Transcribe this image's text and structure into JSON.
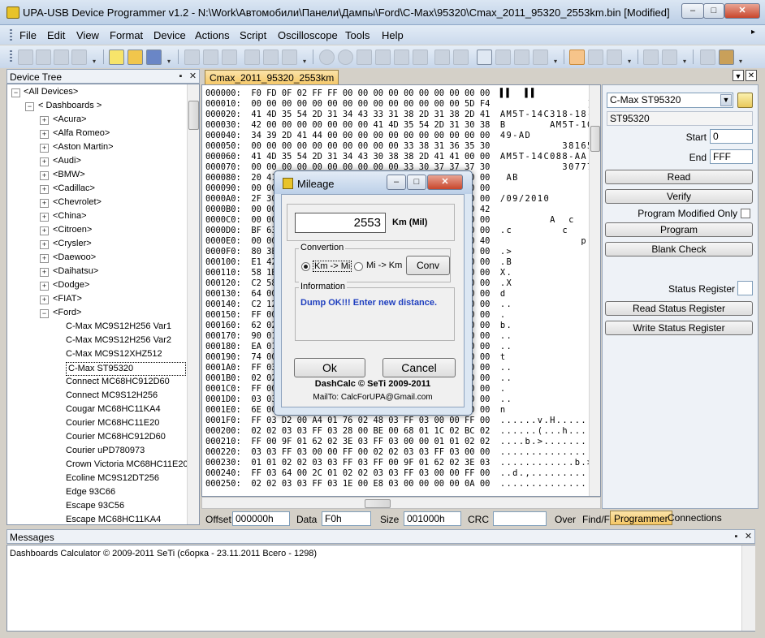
{
  "window": {
    "title": "UPA-USB Device Programmer v1.2 - N:\\Work\\Автомобили\\Панели\\Дампы\\Ford\\C-Max\\95320\\Cmax_2011_95320_2553km.bin [Modified]",
    "minimize": "–",
    "maximize": "□",
    "close": "✕"
  },
  "menu": [
    "File",
    "Edit",
    "View",
    "Format",
    "Device",
    "Actions",
    "Script",
    "Oscilloscope",
    "Tools",
    "Help"
  ],
  "device_tree": {
    "title": "Device Tree",
    "pin": "▪",
    "close": "✕",
    "root": "<All Devices>",
    "group": "< Dashboards >",
    "brands": [
      "<Acura>",
      "<Alfa Romeo>",
      "<Aston Martin>",
      "<Audi>",
      "<BMW>",
      "<Cadillac>",
      "<Chevrolet>",
      "<China>",
      "<Citroen>",
      "<Crysler>",
      "<Daewoo>",
      "<Daihatsu>",
      "<Dodge>",
      "<FIAT>"
    ],
    "open_brand": "<Ford>",
    "ford_items": [
      "C-Max MC9S12H256 Var1",
      "C-Max MC9S12H256 Var2",
      "C-Max MC9S12XHZ512",
      "C-Max ST95320",
      "Connect MC68HC912D60",
      "Connect MC9S12H256",
      "Cougar MC68HC11KA4",
      "Courier MC68HC11E20",
      "Courier MC68HC912D60",
      "Courier uPD780973",
      "Crown Victoria MC68HC11E20",
      "Ecoline MC9S12DT256",
      "Edge 93C66",
      "Escape 93C56",
      "Escape MC68HC11KA4"
    ],
    "selected_index": 3
  },
  "document_tab": "Cmax_2011_95320_2553km",
  "hex": {
    "rows": [
      {
        "addr": "000000:",
        "bytes": "F0 FD 0F 02 FF FF 00 00 00 00 00 00 00 00 00 00",
        "ascii": "▌▌  ▌▌          "
      },
      {
        "addr": "000010:",
        "bytes": "00 00 00 00 00 00 00 00 00 00 00 00 00 00 5D F4",
        "ascii": "              ]."
      },
      {
        "addr": "000020:",
        "bytes": "41 4D 35 54 2D 31 34 43 33 31 38 2D 31 38 2D 41",
        "ascii": "AM5T-14C318-18-A"
      },
      {
        "addr": "000030:",
        "bytes": "42 00 00 00 00 00 00 00 41 4D 35 54 2D 31 30 38",
        "ascii": "B       AM5T-108"
      },
      {
        "addr": "000040:",
        "bytes": "34 39 2D 41 44 00 00 00 00 00 00 00 00 00 00 00",
        "ascii": "49-AD           "
      },
      {
        "addr": "000050:",
        "bytes": "00 00 00 00 00 00 00 00 00 00 33 38 31 36 35 30",
        "ascii": "          381650"
      },
      {
        "addr": "000060:",
        "bytes": "41 4D 35 54 2D 31 34 43 30 38 38 2D 41 41 00 00",
        "ascii": "AM5T-14C088-AA  "
      },
      {
        "addr": "000070:",
        "bytes": "00 00 00 00 00 00 00 00 00 00 33 30 37 37 37 30",
        "ascii": "          307770"
      },
      {
        "addr": "000080:",
        "bytes": "20 41 42 00 00 00 00 00 00 00 00 00 00 00 00 00",
        "ascii": " AB             "
      },
      {
        "addr": "000090:",
        "bytes": "00 00 00 00 00 00 00 00 00 00 00 00 00 00 00 00",
        "ascii": "                "
      },
      {
        "addr": "0000A0:",
        "bytes": "2F 30 39 2F 32 30 31 30 00 00 00 00 00 00 00 00",
        "ascii": "/09/2010        "
      },
      {
        "addr": "0000B0:",
        "bytes": "00 00 00 00 00 00 00 00 00 00 00 00 00 00 00 42",
        "ascii": "               B"
      },
      {
        "addr": "0000C0:",
        "bytes": "00 00 00 00 00 00 00 00 41 00 00 63 00 00 00 00",
        "ascii": "        A  c    "
      },
      {
        "addr": "0000D0:",
        "bytes": "BF 63 00 00 00 00 00 00 00 00 63 00 00 00 00 00",
        "ascii": ".c        c     "
      },
      {
        "addr": "0000E0:",
        "bytes": "00 00 00 00 00 00 00 00 00 00 00 00 00 70 00 40",
        "ascii": "             p @"
      },
      {
        "addr": "0000F0:",
        "bytes": "80 3E 00 00 00 00 00 00 00 00 00 00 00 00 00 00",
        "ascii": ".>              "
      },
      {
        "addr": "000100:",
        "bytes": "E1 42 00 00 00 00 00 00 00 00 00 00 00 00 00 00",
        "ascii": ".B              "
      },
      {
        "addr": "000110:",
        "bytes": "58 1B 00 00 00 00 00 00 00 00 00 00 00 00 00 00",
        "ascii": "X.              "
      },
      {
        "addr": "000120:",
        "bytes": "C2 58 00 00 00 00 00 00 00 00 00 00 00 00 00 00",
        "ascii": ".X              "
      },
      {
        "addr": "000130:",
        "bytes": "64 00 00 00 00 00 00 00 00 00 00 00 00 00 00 00",
        "ascii": "d               "
      },
      {
        "addr": "000140:",
        "bytes": "C2 12 00 00 00 00 00 00 00 00 00 00 00 00 00 00",
        "ascii": "..              "
      },
      {
        "addr": "000150:",
        "bytes": "FF 00 00 00 00 00 00 00 00 00 00 00 00 00 00 00",
        "ascii": ".               "
      },
      {
        "addr": "000160:",
        "bytes": "62 02 00 00 00 00 00 00 00 00 00 00 00 00 00 00",
        "ascii": "b.              "
      },
      {
        "addr": "000170:",
        "bytes": "90 01 00 00 00 00 00 00 00 00 00 00 00 00 00 00",
        "ascii": "..              "
      },
      {
        "addr": "000180:",
        "bytes": "EA 01 00 00 00 00 00 00 00 00 00 00 00 00 00 00",
        "ascii": "..              "
      },
      {
        "addr": "000190:",
        "bytes": "74 00 00 00 00 00 00 00 00 00 00 00 00 00 00 00",
        "ascii": "t               "
      },
      {
        "addr": "0001A0:",
        "bytes": "FF 03 00 00 00 00 00 00 00 00 00 00 00 00 00 00",
        "ascii": "..              "
      },
      {
        "addr": "0001B0:",
        "bytes": "02 02 00 00 00 00 00 00 00 00 00 00 00 00 00 00",
        "ascii": "..              "
      },
      {
        "addr": "0001C0:",
        "bytes": "FF 00 00 00 00 00 00 00 00 00 00 00 00 00 00 00",
        "ascii": ".               "
      },
      {
        "addr": "0001D0:",
        "bytes": "03 03 00 00 00 00 00 00 00 00 00 00 00 00 00 00",
        "ascii": "..              "
      },
      {
        "addr": "0001E0:",
        "bytes": "6E 00 00 00 00 00 00 00 00 00 00 00 00 00 00 00",
        "ascii": "n               "
      },
      {
        "addr": "0001F0:",
        "bytes": "FF 03 D2 00 A4 01 76 02 48 03 FF 03 00 00 FF 00",
        "ascii": "......v.H.......",
        "full": true
      },
      {
        "addr": "000200:",
        "bytes": "02 02 03 03 FF 03 28 00 BE 00 68 01 1C 02 BC 02",
        "ascii": "......(...h.....",
        "full": true
      },
      {
        "addr": "000210:",
        "bytes": "FF 00 9F 01 62 02 3E 03 FF 03 00 00 01 01 02 02",
        "ascii": "....b.>.........",
        "full": true
      },
      {
        "addr": "000220:",
        "bytes": "03 03 FF 03 00 00 FF 00 02 02 03 03 FF 03 00 00",
        "ascii": "................",
        "full": true
      },
      {
        "addr": "000230:",
        "bytes": "01 01 02 02 03 03 FF 03 FF 00 9F 01 62 02 3E 03",
        "ascii": "............b.>.",
        "full": true
      },
      {
        "addr": "000240:",
        "bytes": "FF 03 64 00 2C 01 02 02 03 03 FF 03 00 00 FF 00",
        "ascii": "..d.,...........",
        "full": true
      },
      {
        "addr": "000250:",
        "bytes": "02 02 03 03 FF 03 1E 00 E8 03 00 00 00 00 0A 00",
        "ascii": "................",
        "full": true
      }
    ]
  },
  "statusbar": {
    "offset_label": "Offset",
    "offset_value": "000000h",
    "data_label": "Data",
    "data_value": "F0h",
    "size_label": "Size",
    "size_value": "001000h",
    "crc_label": "CRC",
    "crc_value": "",
    "over_label": "Over",
    "find_label": "Find/F"
  },
  "programmer": {
    "device_select": "C-Max ST95320",
    "chip_name": "ST95320",
    "start_label": "Start",
    "start_value": "0",
    "end_label": "End",
    "end_value": "FFF",
    "read": "Read",
    "verify": "Verify",
    "program_modified_only": "Program Modified Only",
    "program": "Program",
    "blank_check": "Blank Check",
    "status_register": "Status Register",
    "read_status_register": "Read Status Register",
    "write_status_register": "Write Status Register",
    "tabs": [
      "Programmer",
      "Connections"
    ]
  },
  "messages": {
    "title": "Messages",
    "line": "Dashboards Calculator © 2009-2011 SeTi (сборка - 23.11.2011 Всего - 1298)"
  },
  "dialog": {
    "title": "Mileage",
    "mileage_value": "2553",
    "unit_label": "Km (Mil)",
    "conversion_group": "Convertion",
    "radio_km_mi": "Km -> Mi",
    "radio_mi_km": "Mi -> Km",
    "conv_button": "Conv",
    "information_group": "Information",
    "information_text": "Dump OK!!! Enter new distance.",
    "ok": "Ok",
    "cancel": "Cancel",
    "credit": "DashCalc © SeTi 2009-2011",
    "mailto": "MailTo: CalcForUPA@Gmail.com",
    "info_color": "#1f3fbf"
  }
}
